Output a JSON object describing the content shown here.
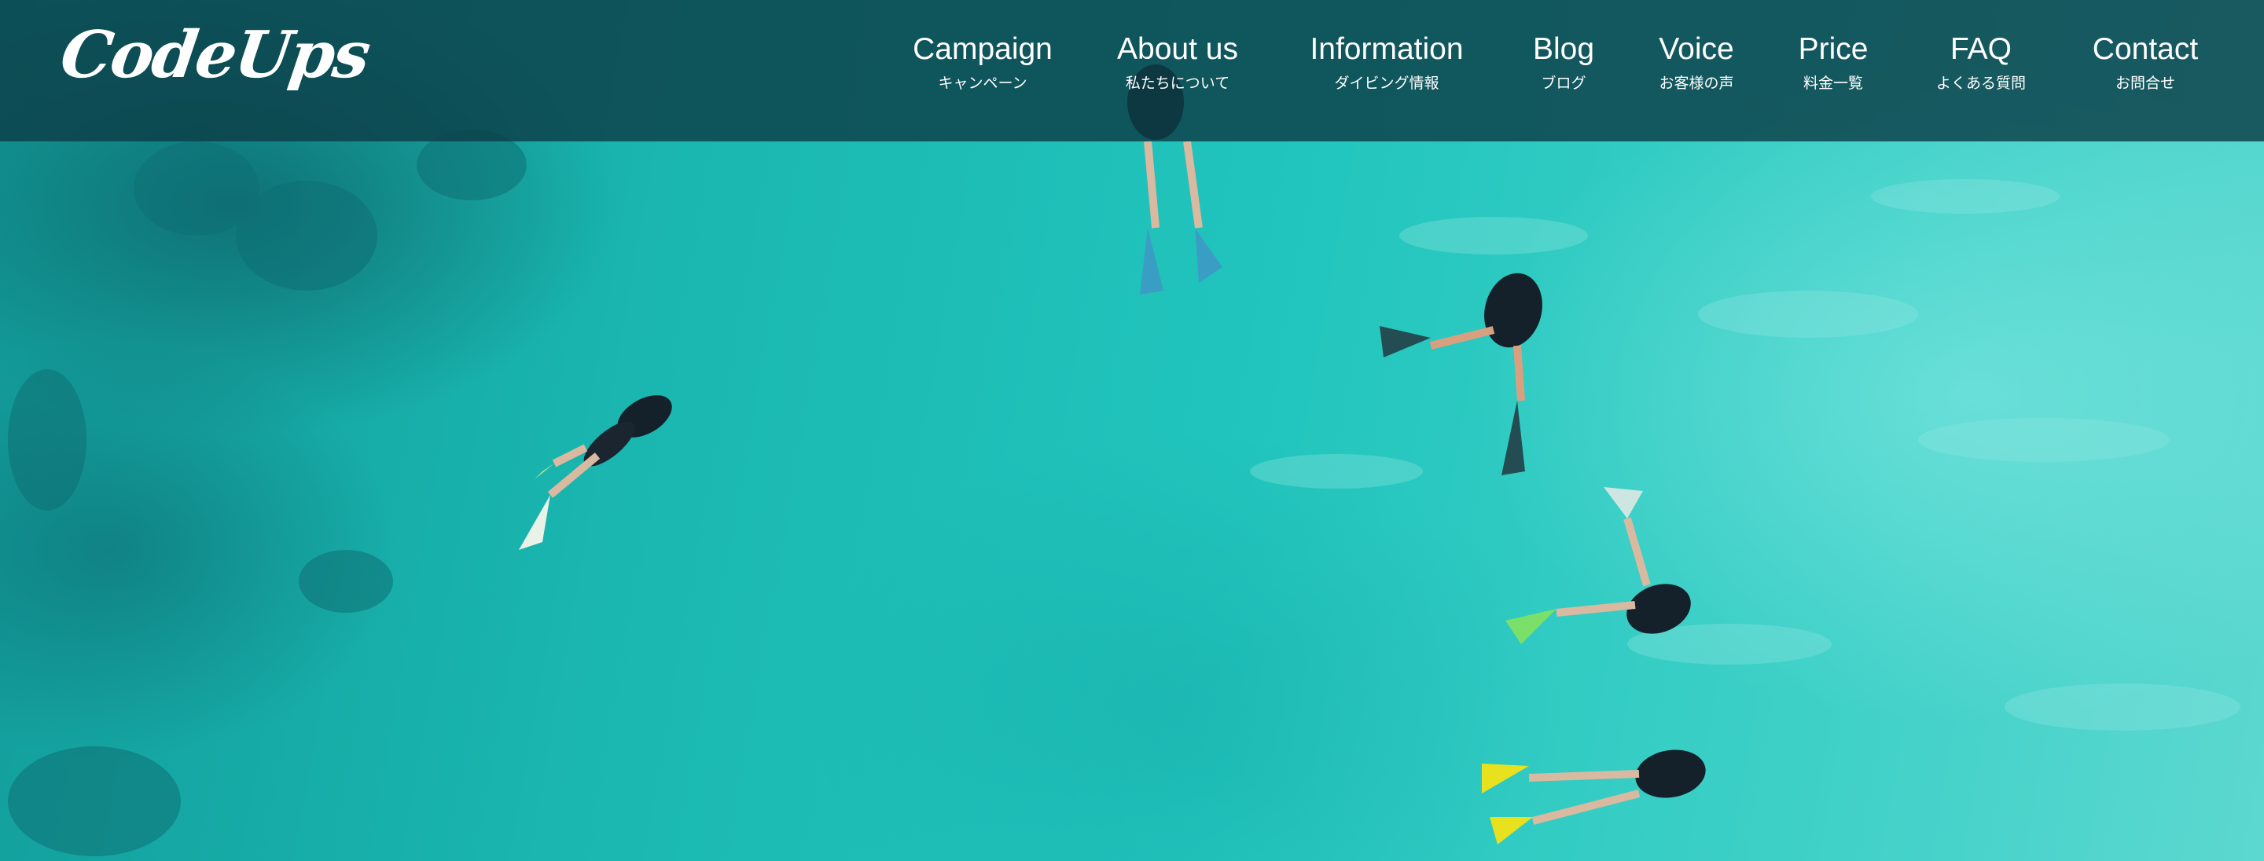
{
  "header": {
    "logo": "CodeUps",
    "nav": [
      {
        "en": "Campaign",
        "ja": "キャンペーン"
      },
      {
        "en": "About us",
        "ja": "私たちについて"
      },
      {
        "en": "Information",
        "ja": "ダイビング情報"
      },
      {
        "en": "Blog",
        "ja": "ブログ"
      },
      {
        "en": "Voice",
        "ja": "お客様の声"
      },
      {
        "en": "Price",
        "ja": "料金一覧"
      },
      {
        "en": "FAQ",
        "ja": "よくある質問"
      },
      {
        "en": "Contact",
        "ja": "お問合せ"
      }
    ]
  },
  "colors": {
    "header_bg": "#0c3e48",
    "water": "#1fbfb6",
    "text": "#ffffff"
  }
}
